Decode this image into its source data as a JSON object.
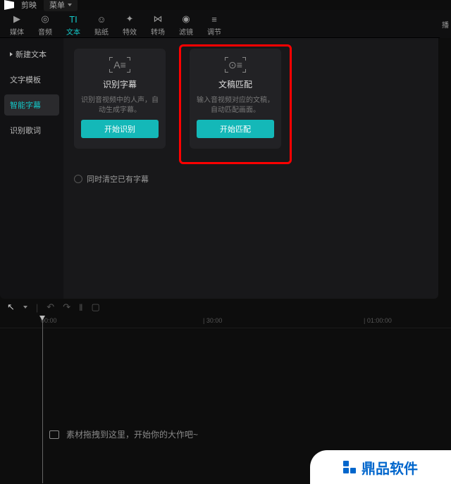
{
  "titlebar": {
    "appname": "剪映",
    "menu": "菜单"
  },
  "tabs": [
    {
      "label": "媒体",
      "icon": "▶"
    },
    {
      "label": "音频",
      "icon": "◎"
    },
    {
      "label": "文本",
      "icon": "TI"
    },
    {
      "label": "贴纸",
      "icon": "☺"
    },
    {
      "label": "特效",
      "icon": "✦"
    },
    {
      "label": "转场",
      "icon": "⋈"
    },
    {
      "label": "滤镜",
      "icon": "◉"
    },
    {
      "label": "调节",
      "icon": "≡"
    }
  ],
  "extra_tab": "播",
  "sidebar": {
    "items": [
      {
        "label": "新建文本",
        "arrow": true
      },
      {
        "label": "文字模板"
      },
      {
        "label": "智能字幕",
        "active": true
      },
      {
        "label": "识别歌词"
      }
    ]
  },
  "cards": [
    {
      "icon": "A≡",
      "title": "识别字幕",
      "desc": "识别音视频中的人声，自动生成字幕。",
      "button": "开始识别"
    },
    {
      "icon": "⊙≡",
      "title": "文稿匹配",
      "desc": "输入音视频对应的文稿，自动匹配画面。",
      "button": "开始匹配",
      "highlight": true
    }
  ],
  "checkbox": {
    "label": "同时清空已有字幕"
  },
  "ruler": {
    "t0": "00:00",
    "t1": "| 30:00",
    "t2": "| 01:00:00"
  },
  "drop_hint": "素材拖拽到这里，开始你的大作吧~",
  "watermark": "鼎品软件"
}
